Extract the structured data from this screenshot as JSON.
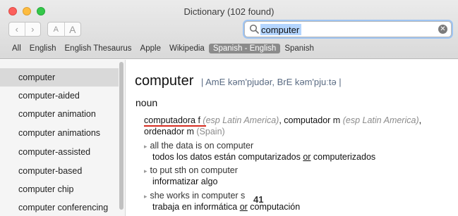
{
  "window": {
    "title": "Dictionary (102 found)"
  },
  "toolbar": {
    "back_label": "‹",
    "forward_label": "›",
    "font_smaller": "A",
    "font_larger": "A",
    "search_value": "computer",
    "clear_glyph": "✕"
  },
  "sources": [
    "All",
    "English",
    "English Thesaurus",
    "Apple",
    "Wikipedia",
    "Spanish - English",
    "Spanish"
  ],
  "active_source": "Spanish - English",
  "sidebar": {
    "items": [
      "computer",
      "computer-aided",
      "computer animation",
      "computer animations",
      "computer-assisted",
      "computer-based",
      "computer chip",
      "computer conferencing"
    ]
  },
  "entry": {
    "headword": "computer",
    "pronunciation": "| AmE kəm'pjudər, BrE kəm'pjuːtə |",
    "part_of_speech": "noun",
    "translation": {
      "w1": "computadora",
      "g1": "f",
      "r1": "(esp Latin America)",
      "sep1": ", ",
      "w2": "computador",
      "g2": "m",
      "r2": "(esp Latin America)",
      "sep2": ",",
      "w3": "ordenador",
      "g3": "m",
      "r3": "(Spain)"
    },
    "examples": [
      {
        "en": "all the data is on computer",
        "es_a": "todos los datos están computarizados ",
        "es_or": "or",
        "es_b": " computerizados"
      },
      {
        "en": "to put sth on computer",
        "es_a": "informatizar algo",
        "es_or": "",
        "es_b": ""
      },
      {
        "en": "she works in computer s",
        "es_a": "trabaja en informática ",
        "es_or": "or",
        "es_b": " computación"
      }
    ],
    "bullet_glyph": "▸"
  },
  "page_number": "41"
}
